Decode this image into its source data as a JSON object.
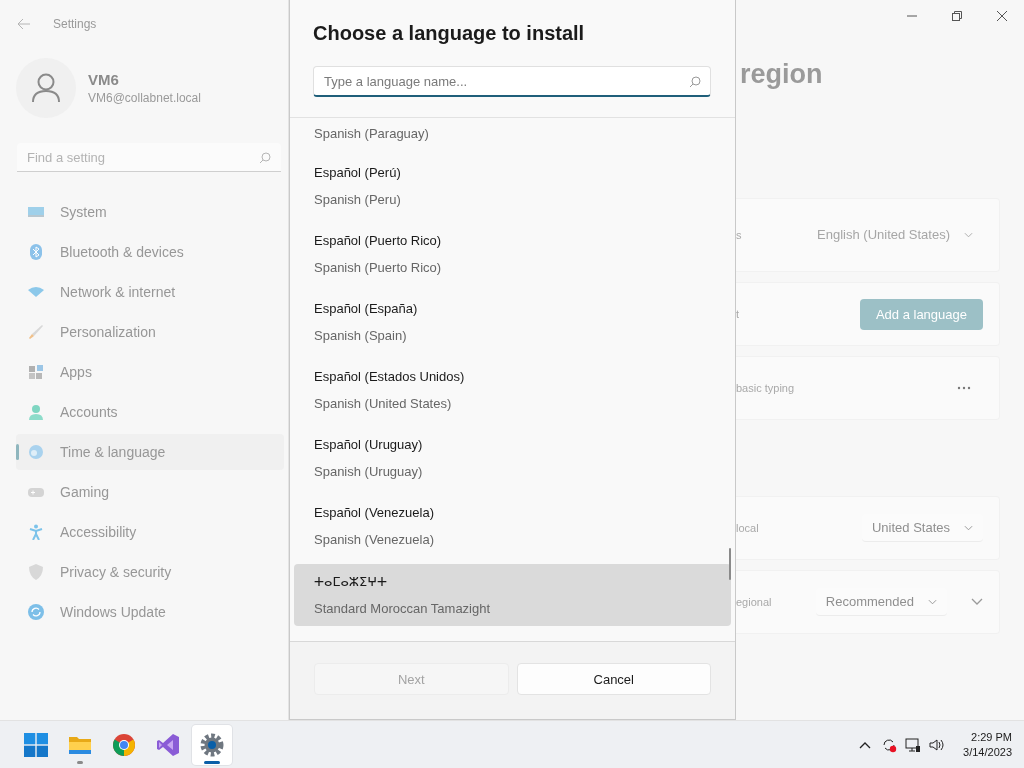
{
  "settings_window": {
    "title": "Settings",
    "user": {
      "name": "VM6",
      "email": "VM6@collabnet.local"
    },
    "search": {
      "placeholder": "Find a setting"
    },
    "nav_items": [
      {
        "label": "System",
        "kind": "system",
        "selected": false
      },
      {
        "label": "Bluetooth & devices",
        "kind": "bluetooth",
        "selected": false
      },
      {
        "label": "Network & internet",
        "kind": "network",
        "selected": false
      },
      {
        "label": "Personalization",
        "kind": "brush",
        "selected": false
      },
      {
        "label": "Apps",
        "kind": "apps",
        "selected": false
      },
      {
        "label": "Accounts",
        "kind": "accounts",
        "selected": false
      },
      {
        "label": "Time & language",
        "kind": "globe",
        "selected": true
      },
      {
        "label": "Gaming",
        "kind": "gamepad",
        "selected": false
      },
      {
        "label": "Accessibility",
        "kind": "accessibility",
        "selected": false
      },
      {
        "label": "Privacy & security",
        "kind": "shield",
        "selected": false
      },
      {
        "label": "Windows Update",
        "kind": "update",
        "selected": false
      }
    ],
    "page_title": "region",
    "sections": [
      {
        "cards": [
          {
            "kind": "dropdown",
            "label": "s",
            "value": "English (United States)",
            "disabled": true
          },
          {
            "kind": "button",
            "label": "t",
            "button": "Add a language"
          },
          {
            "kind": "more",
            "label": "basic typing"
          }
        ]
      },
      {
        "cards": [
          {
            "kind": "dropdown",
            "label": "local",
            "value": "United States",
            "disabled": false
          },
          {
            "kind": "dropdown_expand",
            "label": "egional",
            "value": "Recommended",
            "disabled": false
          }
        ]
      }
    ]
  },
  "dialog": {
    "title": "Choose a language to install",
    "search": {
      "placeholder": "Type a language name..."
    },
    "languages": [
      {
        "english": "Spanish (Paraguay)",
        "selected": false
      },
      {
        "native": "Español (Perú)",
        "english": "Spanish (Peru)",
        "selected": false
      },
      {
        "native": "Español (Puerto Rico)",
        "english": "Spanish (Puerto Rico)",
        "selected": false
      },
      {
        "native": "Español (España)",
        "english": "Spanish (Spain)",
        "selected": false
      },
      {
        "native": "Español (Estados Unidos)",
        "english": "Spanish (United States)",
        "selected": false
      },
      {
        "native": "Español (Uruguay)",
        "english": "Spanish (Uruguay)",
        "selected": false
      },
      {
        "native": "Español (Venezuela)",
        "english": "Spanish (Venezuela)",
        "selected": false
      },
      {
        "native": "ⵜⴰⵎⴰⵣⵉⵖⵜ",
        "english": "Standard Moroccan Tamazight",
        "selected": true
      }
    ],
    "buttons": [
      {
        "label": "Next",
        "disabled": true
      },
      {
        "label": "Cancel",
        "disabled": false
      }
    ]
  },
  "taskbar": {
    "apps": [
      {
        "kind": "start",
        "running": false,
        "selected": false
      },
      {
        "kind": "folder",
        "running": true,
        "selected": false
      },
      {
        "kind": "chrome",
        "running": false,
        "selected": false
      },
      {
        "kind": "visual-studio",
        "running": false,
        "selected": false
      },
      {
        "kind": "settings",
        "running": true,
        "selected": true
      }
    ],
    "time": "2:29 PM",
    "date": "3/14/2023"
  }
}
